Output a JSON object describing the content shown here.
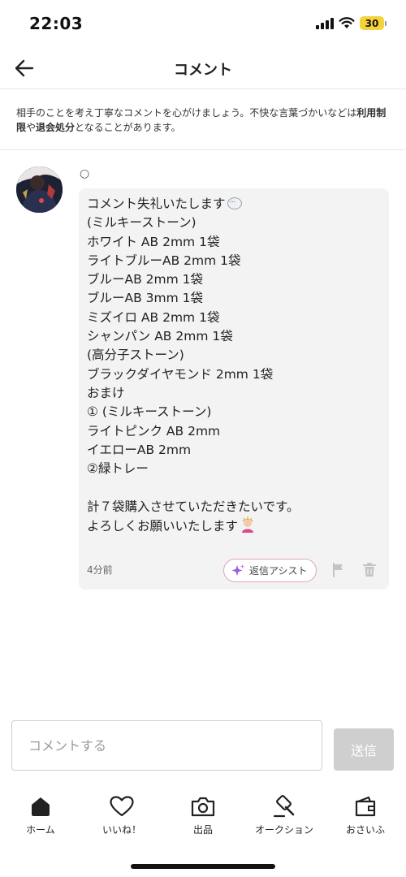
{
  "status_bar": {
    "time": "22:03",
    "battery": "30",
    "battery_color": "#f5d33a"
  },
  "header": {
    "title": "コメント",
    "back_icon": "arrow-left-icon"
  },
  "notice": {
    "prefix": "相手のことを考え丁寧なコメントを心がけましょう。不快な言葉づかいなどは",
    "bold1": "利用制限",
    "mid": "や",
    "bold2": "退会処分",
    "suffix": "となることがあります。"
  },
  "comment": {
    "username": "○",
    "line1": "コメント失礼いたします",
    "body": "\n(ミルキーストーン)\nホワイト AB 2mm 1袋\nライトブルーAB 2mm 1袋\nブルーAB 2mm 1袋\nブルーAB 3mm 1袋\nミズイロ AB 2mm 1袋\nシャンパン AB 2mm 1袋\n(高分子ストーン)\nブラックダイヤモンド 2mm 1袋\nおまけ\n① (ミルキーストーン)\nライトピンク AB 2mm\nイエローAB 2mm\n②緑トレー\n\n計７袋購入させていただきたいです。",
    "last_line": "よろしくお願いいたします",
    "time_ago": "4分前",
    "assist_label": "返信アシスト",
    "assist_border_color": "#e3a2cc",
    "assist_icon_color": "#9b5de5"
  },
  "composer": {
    "placeholder": "コメントする",
    "value": "",
    "send_label": "送信",
    "send_bg": "#cfcfcf"
  },
  "nav": [
    {
      "label": "ホーム",
      "icon": "home-icon"
    },
    {
      "label": "いいね！",
      "icon": "heart-icon"
    },
    {
      "label": "出品",
      "icon": "camera-icon"
    },
    {
      "label": "オークション",
      "icon": "gavel-icon"
    },
    {
      "label": "おさいふ",
      "icon": "wallet-icon"
    }
  ]
}
